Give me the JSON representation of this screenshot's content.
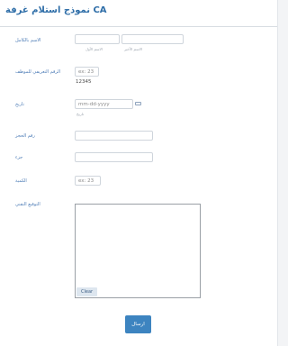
{
  "form": {
    "title": "CA نموذج استلام غرفة",
    "full_name": {
      "label": "الاسم بالكامل",
      "first_sub": "الاسم الأول",
      "last_sub": "الاسم الأخير"
    },
    "employee_id": {
      "label": "الرقم التعريفي للموظف",
      "placeholder": "ex: 23",
      "example": "12345"
    },
    "date": {
      "label": "تاريخ",
      "placeholder": "mm-dd-yyyy",
      "sub": "تاريخ"
    },
    "booking_number": {
      "label": "رقم الحجز"
    },
    "part": {
      "label": "جزء"
    },
    "quantity": {
      "label": "الكمية",
      "placeholder": "ex: 23"
    },
    "signature": {
      "label": "التوقيع النقني",
      "clear_label": "Clear"
    },
    "submit_label": "ارسال"
  }
}
